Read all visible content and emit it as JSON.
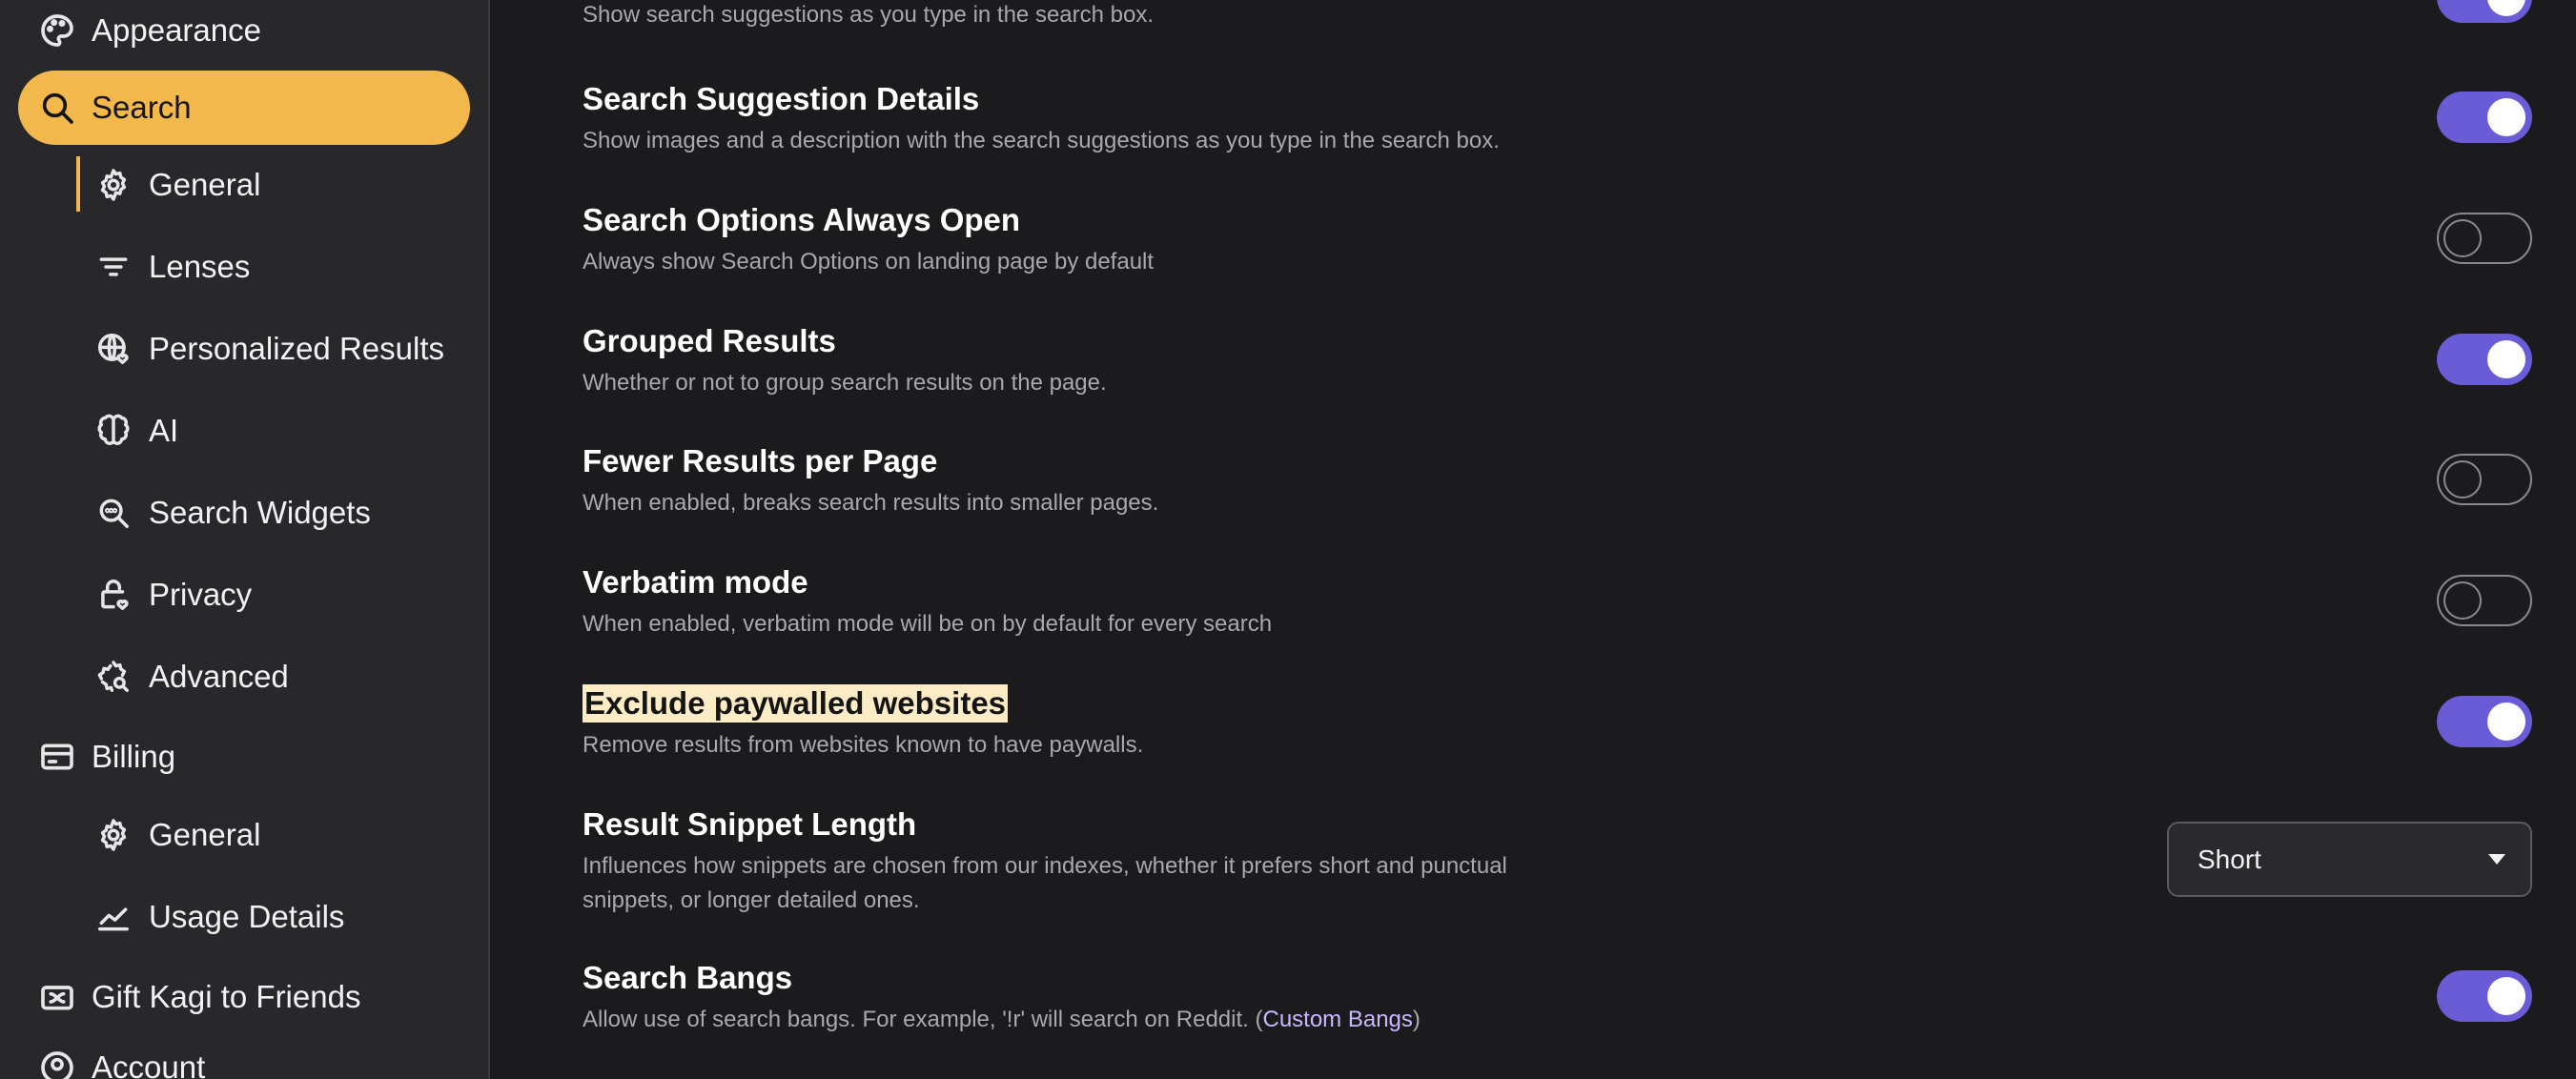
{
  "sidebar": {
    "appearance": "Appearance",
    "search": "Search",
    "search_sub": {
      "general": "General",
      "lenses": "Lenses",
      "personalized": "Personalized Results",
      "ai": "AI",
      "widgets": "Search Widgets",
      "privacy": "Privacy",
      "advanced": "Advanced"
    },
    "billing": "Billing",
    "billing_sub": {
      "general": "General",
      "usage": "Usage Details"
    },
    "gift": "Gift Kagi to Friends",
    "account": "Account"
  },
  "settings": {
    "suggestions": {
      "desc": "Show search suggestions as you type in the search box.",
      "enabled": true
    },
    "suggestion_details": {
      "title": "Search Suggestion Details",
      "desc": "Show images and a description with the search suggestions as you type in the search box.",
      "enabled": true
    },
    "options_open": {
      "title": "Search Options Always Open",
      "desc": "Always show Search Options on landing page by default",
      "enabled": false
    },
    "grouped": {
      "title": "Grouped Results",
      "desc": "Whether or not to group search results on the page.",
      "enabled": true
    },
    "fewer": {
      "title": "Fewer Results per Page",
      "desc": "When enabled, breaks search results into smaller pages.",
      "enabled": false
    },
    "verbatim": {
      "title": "Verbatim mode",
      "desc": "When enabled, verbatim mode will be on by default for every search",
      "enabled": false
    },
    "paywalled": {
      "title": "Exclude paywalled websites",
      "desc": "Remove results from websites known to have paywalls.",
      "enabled": true
    },
    "snippet": {
      "title": "Result Snippet Length",
      "desc": "Influences how snippets are chosen from our indexes, whether it prefers short and punctual snippets, or longer detailed ones.",
      "value": "Short"
    },
    "bangs": {
      "title": "Search Bangs",
      "desc_before": "Allow use of search bangs. For example, '!r' will search on Reddit. (",
      "link": "Custom Bangs",
      "desc_after": ")",
      "enabled": true
    }
  },
  "colors": {
    "accent": "#f2b84b",
    "toggle_on": "#6a5bd6",
    "highlight": "#fbecc6"
  }
}
